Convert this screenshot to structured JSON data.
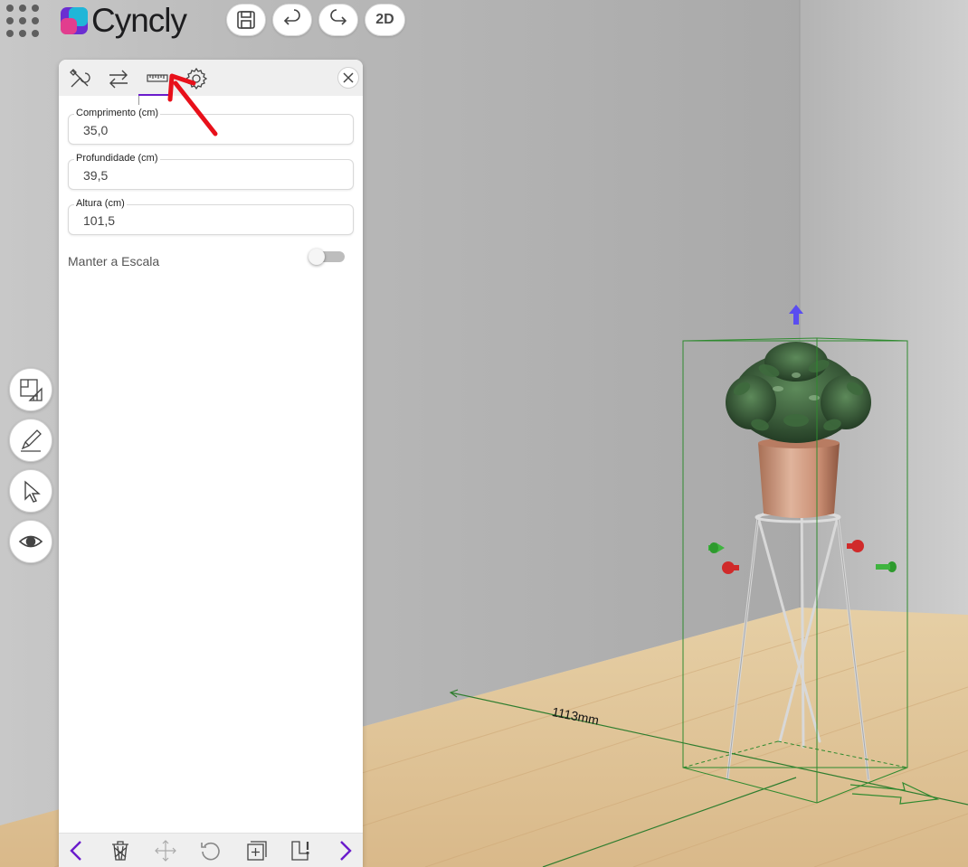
{
  "brand": {
    "name": "Cyncly"
  },
  "toolbar": {
    "view_2d_label": "2D"
  },
  "panel": {
    "fields": [
      {
        "label": "Comprimento (cm)",
        "value": "35,0"
      },
      {
        "label": "Profundidade (cm)",
        "value": "39,5"
      },
      {
        "label": "Altura (cm)",
        "value": "101,5"
      }
    ],
    "keep_scale_label": "Manter a Escala",
    "keep_scale_on": false
  },
  "scene": {
    "dimension_label": "1113mm"
  },
  "colors": {
    "accent": "#6a1bcc",
    "bbox": "#2f8a2f",
    "annotation_arrow": "#e8101a"
  }
}
